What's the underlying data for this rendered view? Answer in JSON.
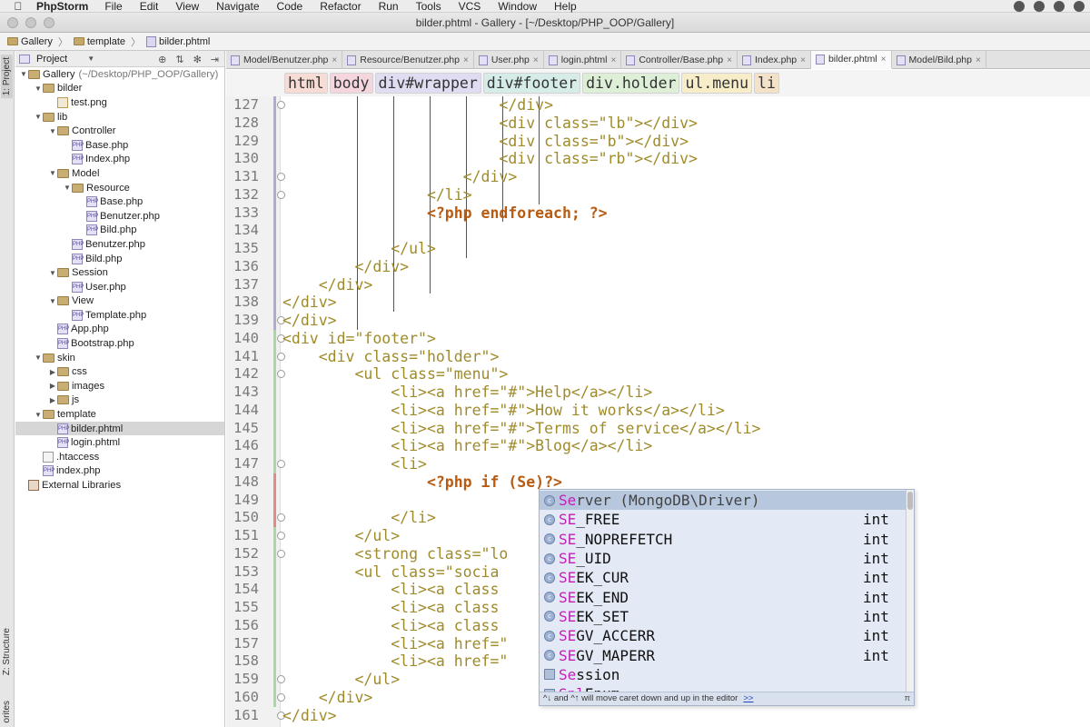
{
  "menubar": {
    "app": "PhpStorm",
    "items": [
      "File",
      "Edit",
      "View",
      "Navigate",
      "Code",
      "Refactor",
      "Run",
      "Tools",
      "VCS",
      "Window",
      "Help"
    ]
  },
  "window": {
    "title": "bilder.phtml - Gallery - [~/Desktop/PHP_OOP/Gallery]"
  },
  "nav": {
    "crumbs": [
      "Gallery",
      "template",
      "bilder.phtml"
    ]
  },
  "sidebar": {
    "project_label": "1: Project",
    "structure_label": "Z: Structure",
    "favorites_label": "orites"
  },
  "project": {
    "selector": "Project",
    "tree": [
      {
        "label": "Gallery",
        "dim": "(~/Desktop/PHP_OOP/Gallery)",
        "type": "folder",
        "depth": 0,
        "open": true
      },
      {
        "label": "bilder",
        "type": "folder",
        "depth": 1,
        "open": true
      },
      {
        "label": "test.png",
        "type": "img",
        "depth": 2
      },
      {
        "label": "lib",
        "type": "folder",
        "depth": 1,
        "open": true
      },
      {
        "label": "Controller",
        "type": "folder",
        "depth": 2,
        "open": true
      },
      {
        "label": "Base.php",
        "type": "php",
        "depth": 3
      },
      {
        "label": "Index.php",
        "type": "php",
        "depth": 3
      },
      {
        "label": "Model",
        "type": "folder",
        "depth": 2,
        "open": true
      },
      {
        "label": "Resource",
        "type": "folder",
        "depth": 3,
        "open": true
      },
      {
        "label": "Base.php",
        "type": "php",
        "depth": 4
      },
      {
        "label": "Benutzer.php",
        "type": "php",
        "depth": 4
      },
      {
        "label": "Bild.php",
        "type": "php",
        "depth": 4
      },
      {
        "label": "Benutzer.php",
        "type": "php",
        "depth": 3
      },
      {
        "label": "Bild.php",
        "type": "php",
        "depth": 3
      },
      {
        "label": "Session",
        "type": "folder",
        "depth": 2,
        "open": true
      },
      {
        "label": "User.php",
        "type": "php",
        "depth": 3
      },
      {
        "label": "View",
        "type": "folder",
        "depth": 2,
        "open": true
      },
      {
        "label": "Template.php",
        "type": "php",
        "depth": 3
      },
      {
        "label": "App.php",
        "type": "php",
        "depth": 2
      },
      {
        "label": "Bootstrap.php",
        "type": "php",
        "depth": 2
      },
      {
        "label": "skin",
        "type": "folder",
        "depth": 1,
        "open": true
      },
      {
        "label": "css",
        "type": "folder",
        "depth": 2,
        "open": false
      },
      {
        "label": "images",
        "type": "folder",
        "depth": 2,
        "open": false
      },
      {
        "label": "js",
        "type": "folder",
        "depth": 2,
        "open": false
      },
      {
        "label": "template",
        "type": "folder",
        "depth": 1,
        "open": true
      },
      {
        "label": "bilder.phtml",
        "type": "php",
        "depth": 2,
        "selected": true
      },
      {
        "label": "login.phtml",
        "type": "php",
        "depth": 2
      },
      {
        "label": ".htaccess",
        "type": "txt",
        "depth": 1
      },
      {
        "label": "index.php",
        "type": "php",
        "depth": 1
      },
      {
        "label": "External Libraries",
        "type": "lib",
        "depth": 0
      }
    ]
  },
  "tabs": [
    {
      "label": "Model/Benutzer.php"
    },
    {
      "label": "Resource/Benutzer.php"
    },
    {
      "label": "User.php"
    },
    {
      "label": "login.phtml"
    },
    {
      "label": "Controller/Base.php"
    },
    {
      "label": "Index.php"
    },
    {
      "label": "bilder.phtml",
      "active": true
    },
    {
      "label": "Model/Bild.php"
    }
  ],
  "breadcrumb_tags": [
    {
      "label": "html",
      "color": "#f7dcd6"
    },
    {
      "label": "body",
      "color": "#f5d6df"
    },
    {
      "label": "div#wrapper",
      "color": "#e0dcf2"
    },
    {
      "label": "div#footer",
      "color": "#d6ece9"
    },
    {
      "label": "div.holder",
      "color": "#ddefd6"
    },
    {
      "label": "ul.menu",
      "color": "#f7edc9"
    },
    {
      "label": "li",
      "color": "#f4e2c8"
    }
  ],
  "editor": {
    "line_numbers": [
      "127",
      "128",
      "129",
      "130",
      "131",
      "132",
      "133",
      "134",
      "135",
      "136",
      "137",
      "138",
      "139",
      "140",
      "141",
      "142",
      "143",
      "144",
      "145",
      "146",
      "147",
      "148",
      "149",
      "150",
      "151",
      "152",
      "153",
      "154",
      "155",
      "156",
      "157",
      "158",
      "159",
      "160",
      "161"
    ],
    "lines": [
      "                        </div>",
      "                        <div class=\"lb\"></div>",
      "                        <div class=\"b\"></div>",
      "                        <div class=\"rb\"></div>",
      "                    </div>",
      "                </li>",
      "                <?php endforeach; ?>",
      "",
      "            </ul>",
      "        </div>",
      "    </div>",
      "</div>",
      "</div>",
      "<div id=\"footer\">",
      "    <div class=\"holder\">",
      "        <ul class=\"menu\">",
      "            <li><a href=\"#\">Help</a></li>",
      "            <li><a href=\"#\">How it works</a></li>",
      "            <li><a href=\"#\">Terms of service</a></li>",
      "            <li><a href=\"#\">Blog</a></li>",
      "            <li>",
      "                <?php if (Se)?>",
      "",
      "            </li>",
      "        </ul>",
      "        <strong class=\"lo",
      "        <ul class=\"socia",
      "            <li><a class",
      "            <li><a class",
      "            <li><a class",
      "            <li><a href=\"",
      "            <li><a href=\"",
      "        </ul>",
      "    </div>",
      "</div>"
    ]
  },
  "autocomplete": {
    "items": [
      {
        "hl": "Se",
        "rest": "rver (MongoDB\\Driver)",
        "type": "",
        "icon": "c",
        "selected": true
      },
      {
        "hl": "SE",
        "rest": "_FREE",
        "type": "int",
        "icon": "c"
      },
      {
        "hl": "SE",
        "rest": "_NOPREFETCH",
        "type": "int",
        "icon": "c"
      },
      {
        "hl": "SE",
        "rest": "_UID",
        "type": "int",
        "icon": "c"
      },
      {
        "hl": "SE",
        "rest": "EK_CUR",
        "type": "int",
        "icon": "c"
      },
      {
        "hl": "SE",
        "rest": "EK_END",
        "type": "int",
        "icon": "c"
      },
      {
        "hl": "SE",
        "rest": "EK_SET",
        "type": "int",
        "icon": "c"
      },
      {
        "hl": "SE",
        "rest": "GV_ACCERR",
        "type": "int",
        "icon": "c"
      },
      {
        "hl": "SE",
        "rest": "GV_MAPERR",
        "type": "int",
        "icon": "c"
      },
      {
        "hl": "Se",
        "rest": "ssion",
        "type": "",
        "icon": "class"
      },
      {
        "hl": "Spl",
        "rest": "Enum",
        "type": "",
        "icon": "class"
      }
    ],
    "footer_hint": "^↓ and ^↑ will move caret down and up in the editor",
    "footer_link": ">>",
    "pin": "π"
  }
}
